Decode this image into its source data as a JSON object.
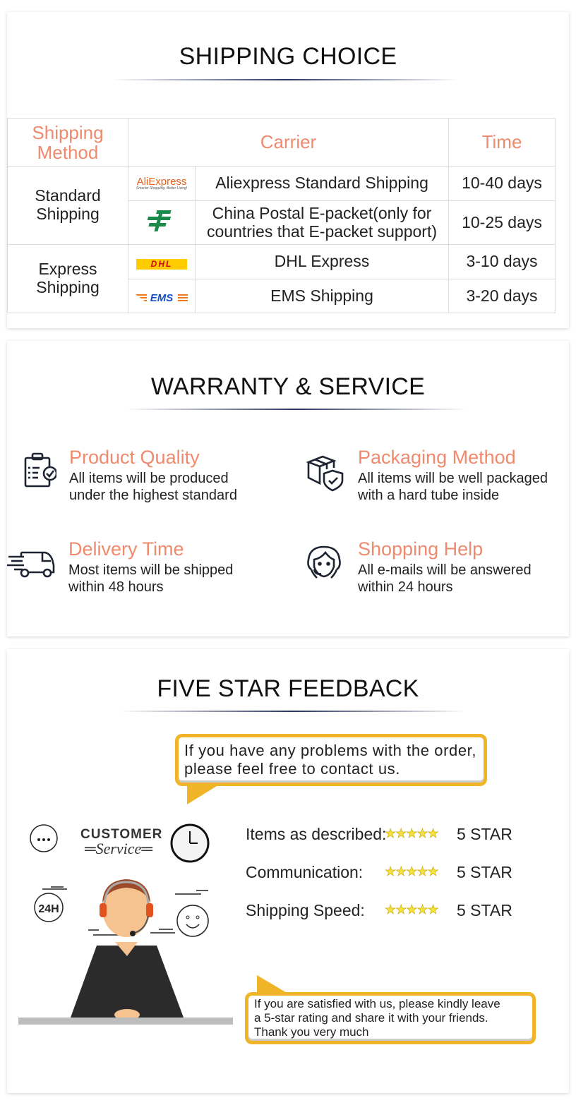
{
  "shipping": {
    "title": "SHIPPING CHOICE",
    "headers": {
      "method": "Shipping Method",
      "carrier": "Carrier",
      "time": "Time"
    },
    "groups": [
      {
        "method": "Standard Shipping",
        "rows": [
          {
            "logo": "aliexpress-logo",
            "logo_text": "AliExpress",
            "logo_tagline": "Smarter Shopping, Better Living!",
            "carrier": "Aliexpress Standard Shipping",
            "time": "10-40 days"
          },
          {
            "logo": "china-post-logo",
            "carrier": "China Postal E-packet(only for countries that E-packet support)",
            "time": "10-25 days"
          }
        ]
      },
      {
        "method": "Express Shipping",
        "rows": [
          {
            "logo": "dhl-logo",
            "logo_text": "DHL",
            "carrier": "DHL Express",
            "time": "3-10 days"
          },
          {
            "logo": "ems-logo",
            "logo_text": "EMS",
            "carrier": "EMS Shipping",
            "time": "3-20 days"
          }
        ]
      }
    ]
  },
  "warranty": {
    "title": "WARRANTY & SERVICE",
    "items": [
      {
        "icon": "clipboard-check-icon",
        "title": "Product Quality",
        "lines": [
          "All items will be produced",
          "under the highest standard"
        ]
      },
      {
        "icon": "package-shield-icon",
        "title": "Packaging Method",
        "lines": [
          "All items will be well packaged",
          "with a hard tube inside"
        ]
      },
      {
        "icon": "delivery-truck-icon",
        "title": "Delivery Time",
        "lines": [
          "Most items will be shipped",
          "within 48 hours"
        ]
      },
      {
        "icon": "support-agent-icon",
        "title": "Shopping Help",
        "lines": [
          "All e-mails will be answered",
          "within 24 hours"
        ]
      }
    ]
  },
  "feedback": {
    "title": "FIVE STAR FEEDBACK",
    "top_bubble": "If you have any problems with the order, please feel free to contact us.",
    "illustration": {
      "heading": "CUSTOMER",
      "subheading": "Service",
      "badge": "24H"
    },
    "ratings": [
      {
        "label": "Items as described:",
        "stars": 5,
        "value": "5 STAR"
      },
      {
        "label": "Communication:",
        "stars": 5,
        "value": "5 STAR"
      },
      {
        "label": "Shipping Speed:",
        "stars": 5,
        "value": "5 STAR"
      }
    ],
    "bottom_bubble": [
      "If you are satisfied with us, please kindly leave",
      "a 5-star rating and share it with your friends.",
      "Thank you very much"
    ]
  },
  "colors": {
    "accent": "#F08A6E",
    "bubble": "#F0B429",
    "title_line": "#2A3560"
  }
}
